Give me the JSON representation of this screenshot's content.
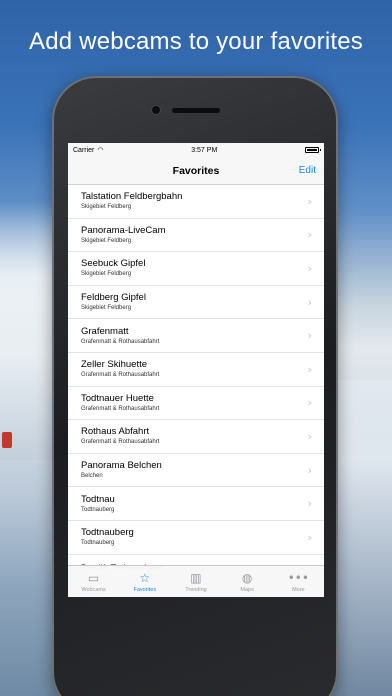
{
  "headline": "Add webcams to your favorites",
  "status_bar": {
    "carrier": "Carrier",
    "wifi_icon": "wifi-icon",
    "time": "3:57 PM",
    "battery_icon": "battery-icon"
  },
  "navbar": {
    "title": "Favorites",
    "edit_label": "Edit"
  },
  "favorites": [
    {
      "title": "Talstation Feldbergbahn",
      "subtitle": "Skigebiet Feldberg"
    },
    {
      "title": "Panorama-LiveCam",
      "subtitle": "Skigebiet Feldberg"
    },
    {
      "title": "Seebuck Gipfel",
      "subtitle": "Skigebiet Feldberg"
    },
    {
      "title": "Feldberg Gipfel",
      "subtitle": "Skigebiet Feldberg"
    },
    {
      "title": "Grafenmatt",
      "subtitle": "Grafenmatt & Rothausabfahrt"
    },
    {
      "title": "Zeller Skihuette",
      "subtitle": "Grafenmatt & Rothausabfahrt"
    },
    {
      "title": "Todtnauer Huette",
      "subtitle": "Grafenmatt & Rothausabfahrt"
    },
    {
      "title": "Rothaus Abfahrt",
      "subtitle": "Grafenmatt & Rothausabfahrt"
    },
    {
      "title": "Panorama Belchen",
      "subtitle": "Belchen"
    },
    {
      "title": "Todtnau",
      "subtitle": "Todtnauberg"
    },
    {
      "title": "Todtnauberg",
      "subtitle": "Todtnauberg"
    }
  ],
  "partial_row_title": "Doplift Todtnauberg",
  "tabs": [
    {
      "label": "Webcams",
      "icon": "video-camera-icon",
      "glyph": "▭",
      "active": false
    },
    {
      "label": "Favorites",
      "icon": "star-icon",
      "glyph": "☆",
      "active": true
    },
    {
      "label": "Trending",
      "icon": "bar-chart-icon",
      "glyph": "▥",
      "active": false
    },
    {
      "label": "Maps",
      "icon": "globe-icon",
      "glyph": "◍",
      "active": false
    },
    {
      "label": "More",
      "icon": "more-icon",
      "glyph": "•••",
      "active": false
    }
  ],
  "colors": {
    "accent": "#1a87e6",
    "tab_inactive": "#9a9a9e"
  }
}
